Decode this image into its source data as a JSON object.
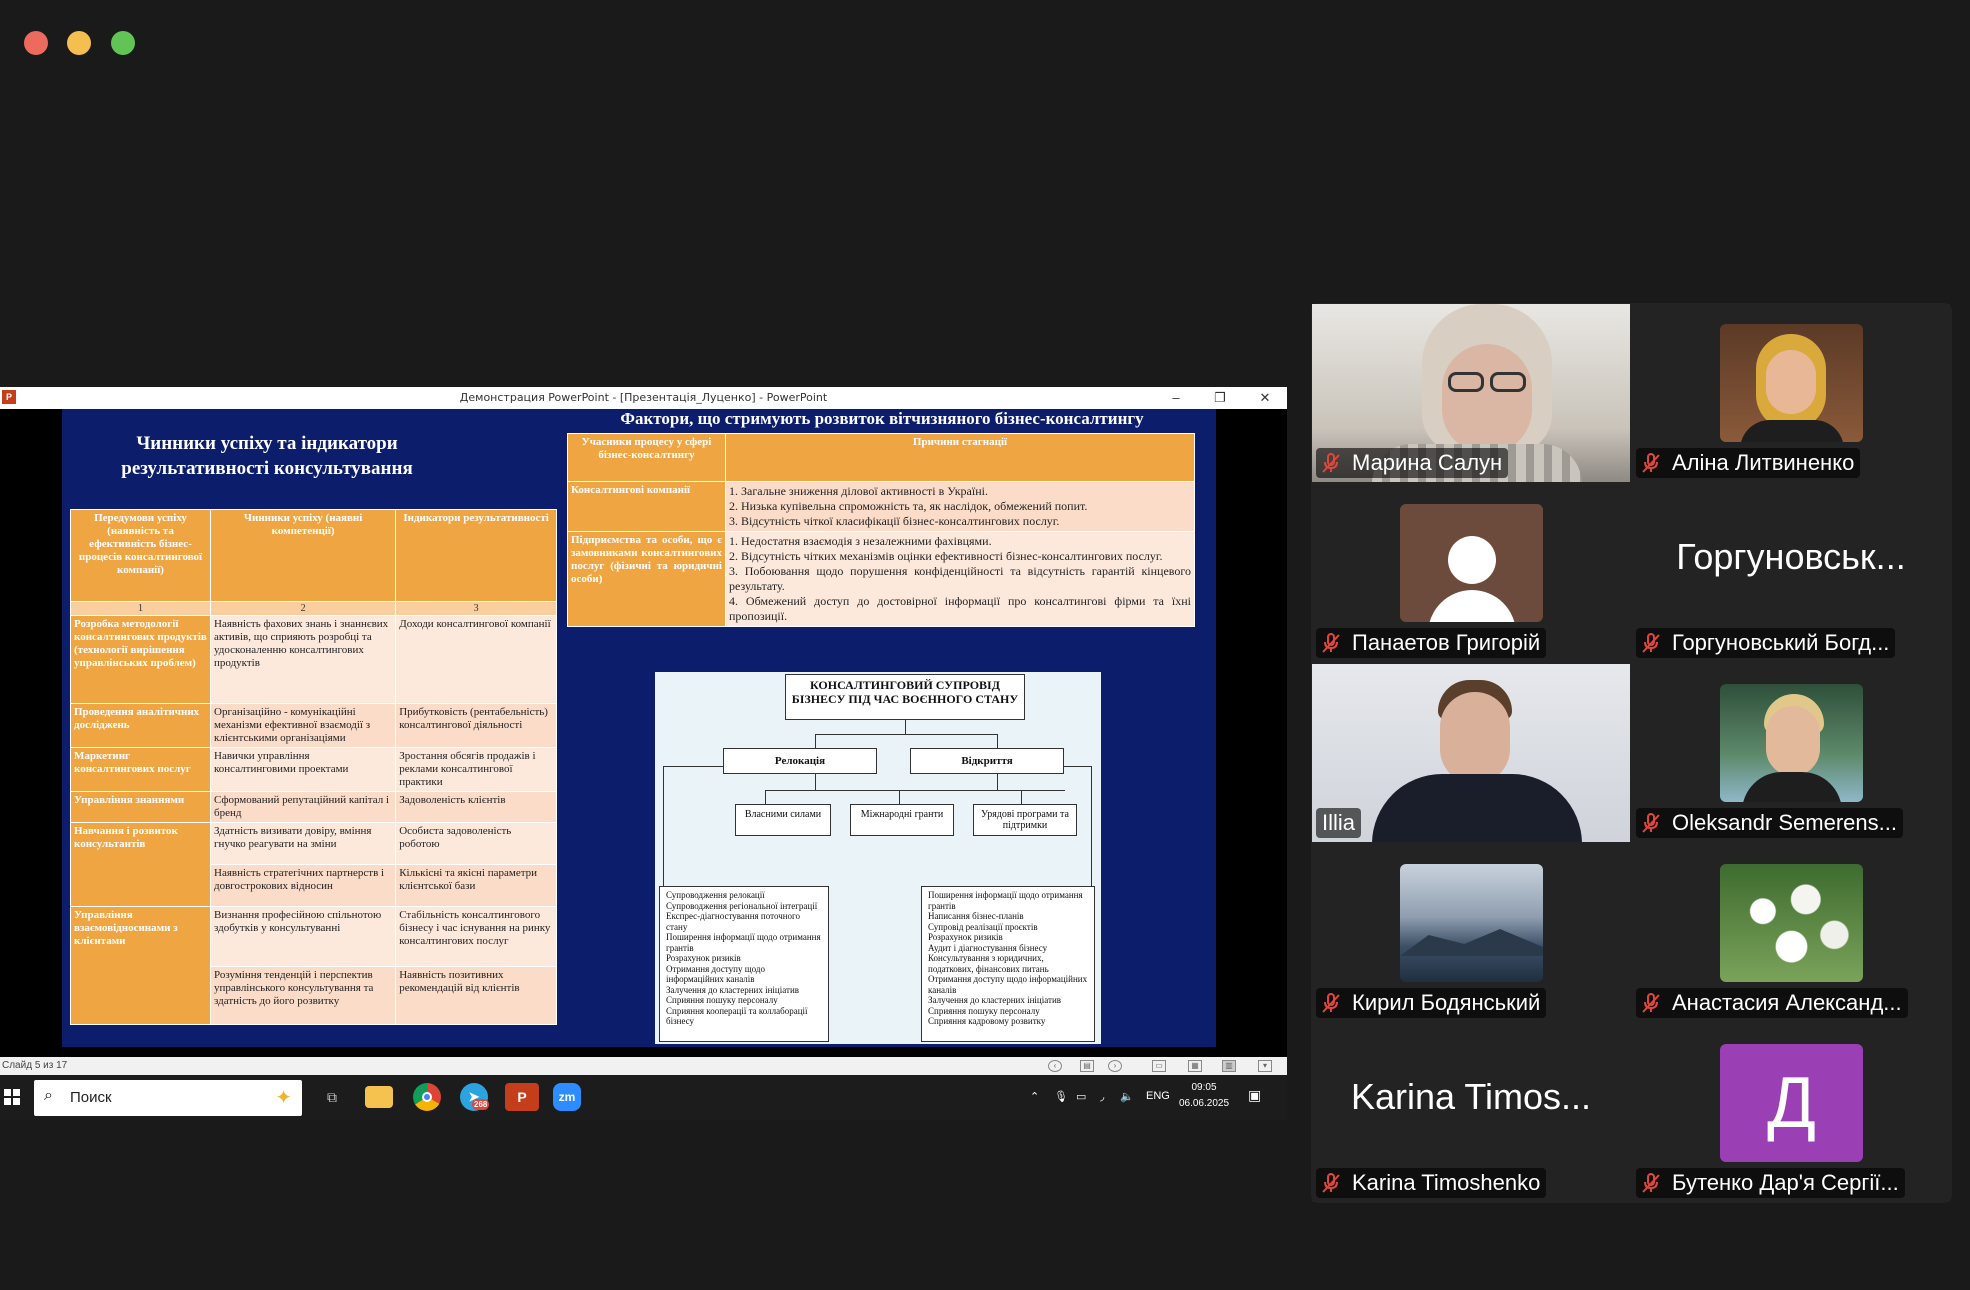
{
  "window": {
    "controls": [
      "close",
      "minimize",
      "zoom"
    ]
  },
  "powerpoint": {
    "title": "Демонстрация PowerPoint - [Презентація_Луценко] - PowerPoint",
    "icon_letter": "P",
    "minimize": "–",
    "restore": "❐",
    "close": "✕",
    "status": "Слайд 5 из 17"
  },
  "slide": {
    "left_title": "Чинники успіху та індикатори результативності консультування",
    "left_table": {
      "headers": [
        "Передумови успіху (наявність та ефективність бізнес-процесів консалтингової компанії)",
        "Чинники успіху (наявні компетенції)",
        "Індикатори результативності"
      ],
      "numbers": [
        "1",
        "2",
        "3"
      ],
      "rows": [
        {
          "label": "Розробка методології консалтингових продуктів (технології вирішення управлінських проблем)",
          "c1": "Наявність фахових знань і знаннєвих активів, що сприяють розробці та удосконаленню консалтингових продуктів",
          "c2": "Доходи консалтингової компанії"
        },
        {
          "label": "Проведення аналітичних досліджень",
          "c1": "Організаційно - комунікаційні механізми ефективної взаємодії з клієнтськими організаціями",
          "c2": "Прибутковість (рентабельність) консалтингової діяльності"
        },
        {
          "label": "Маркетинг консалтингових послуг",
          "c1": "Навички управління консалтинговими проектами",
          "c2": "Зростання обсягів продажів і реклами консалтингової практики"
        },
        {
          "label": "Управління знаннями",
          "c1": "Сформований репутаційний капітал і бренд",
          "c2": "Задоволеність клієнтів"
        },
        {
          "label": "Навчання і розвиток консультантів",
          "c1": "Здатність визивати довіру, вміння гнучко реагувати на зміни",
          "c2": "Особиста задоволеність роботою"
        },
        {
          "label": "",
          "c1": "Наявність стратегічних партнерств і довгострокових відносин",
          "c2": "Кількісні та якісні параметри клієнтської бази"
        },
        {
          "label": "Управління взаємовідносинами з клієнтами",
          "c1": "Визнання професійною спільнотою здобутків у консультуванні",
          "c2": "Стабільність консалтингового бізнесу і час існування на ринку консалтингових послуг"
        },
        {
          "label": "",
          "c1": "Розуміння тенденцій і перспектив управлінського консультування та здатність до його розвитку",
          "c2": "Наявність позитивних рекомендацій від клієнтів"
        }
      ]
    },
    "right_title": "Фактори, що стримують розвиток вітчизняного бізнес-консалтингу",
    "right_table": {
      "headers": [
        "Учасники процесу у сфері бізнес-консалтингу",
        "Причини стагнації"
      ],
      "rows": [
        {
          "label": "Консалтингові компанії",
          "items": [
            "1. Загальне зниження ділової активності в Україні.",
            "2. Низька купівельна спроможність та, як наслідок, обмежений попит.",
            "3. Відсутність чіткої класифікації бізнес-консалтингових послуг."
          ]
        },
        {
          "label": "Підприємства та особи, що є замовниками консалтингових послуг (фізичні та юридичні особи)",
          "items": [
            "1. Недостатня взаємодія з незалежними фахівцями.",
            "2. Відсутність чітких механізмів оцінки ефективності бізнес-консалтингових послуг.",
            "3. Побоювання щодо порушення конфіденційності та відсутність гарантій кінцевого результату.",
            "4. Обмежений доступ до достовірної інформації про консалтингові фірми та їхні пропозиції."
          ]
        }
      ]
    },
    "diagram": {
      "title": "КОНСАЛТИНГОВИЙ СУПРОВІД БІЗНЕСУ ПІД ЧАС ВОЄННОГО СТАНУ",
      "left_branch": "Релокація",
      "right_branch": "Відкриття",
      "sub1": "Власними силами",
      "sub2": "Міжнародні гранти",
      "sub3": "Урядові програми та підтримки",
      "left_list": [
        "Супроводження релокації",
        "Супроводження регіональної інтеграції",
        "Експрес-діагностування поточного стану",
        "Поширення інформації щодо отримання грантів",
        "Розрахунок ризиків",
        "Отримання доступу щодо інформаційних каналів",
        "Залучення до кластерних ініціатив",
        "Сприяння пошуку персоналу",
        "Сприяння кооперації та коллаборації бізнесу"
      ],
      "right_list": [
        "Поширення інформації щодо отримання грантів",
        "Написання бізнес-планів",
        "Супровід реалізації проєктів",
        "Розрахунок ризиків",
        "Аудит і діагностування бізнесу",
        "Консультування з юридичних, податкових, фінансових питань",
        "Отримання доступу щодо інформаційних каналів",
        "Залучення до кластерних ініціатив",
        "Сприяння пошуку персоналу",
        "Сприяння кадровому розвитку"
      ]
    }
  },
  "taskbar": {
    "search_placeholder": "Поиск",
    "telegram_badge": "268",
    "lang": "ENG",
    "time": "09:05",
    "date": "06.06.2025"
  },
  "participants": [
    {
      "name": "Марина Салун",
      "type": "video",
      "muted": true
    },
    {
      "name": "Аліна Литвиненко",
      "type": "photo",
      "muted": true
    },
    {
      "name": "Панаетов Григорій",
      "type": "placeholder",
      "muted": true
    },
    {
      "name": "Горгуновський Богд...",
      "big": "Горгуновськ...",
      "type": "text",
      "muted": true
    },
    {
      "name": "Illia",
      "type": "video",
      "muted": false,
      "active": true
    },
    {
      "name": "Oleksandr Semerens...",
      "type": "photo",
      "muted": true
    },
    {
      "name": "Кирил Бодянський",
      "type": "photo",
      "muted": true
    },
    {
      "name": "Анастасия Александ...",
      "type": "photo",
      "muted": true
    },
    {
      "name": "Karina Timoshenko",
      "big": "Karina Timos...",
      "type": "text",
      "muted": true
    },
    {
      "name": "Бутенко Дар'я Сергії...",
      "letter": "Д",
      "type": "letter",
      "muted": true
    }
  ],
  "colors": {
    "slide_bg": "#0c1d6b",
    "table_header": "#f0a543",
    "active_speaker": "#4cd964",
    "mute_icon": "#e0463c"
  }
}
